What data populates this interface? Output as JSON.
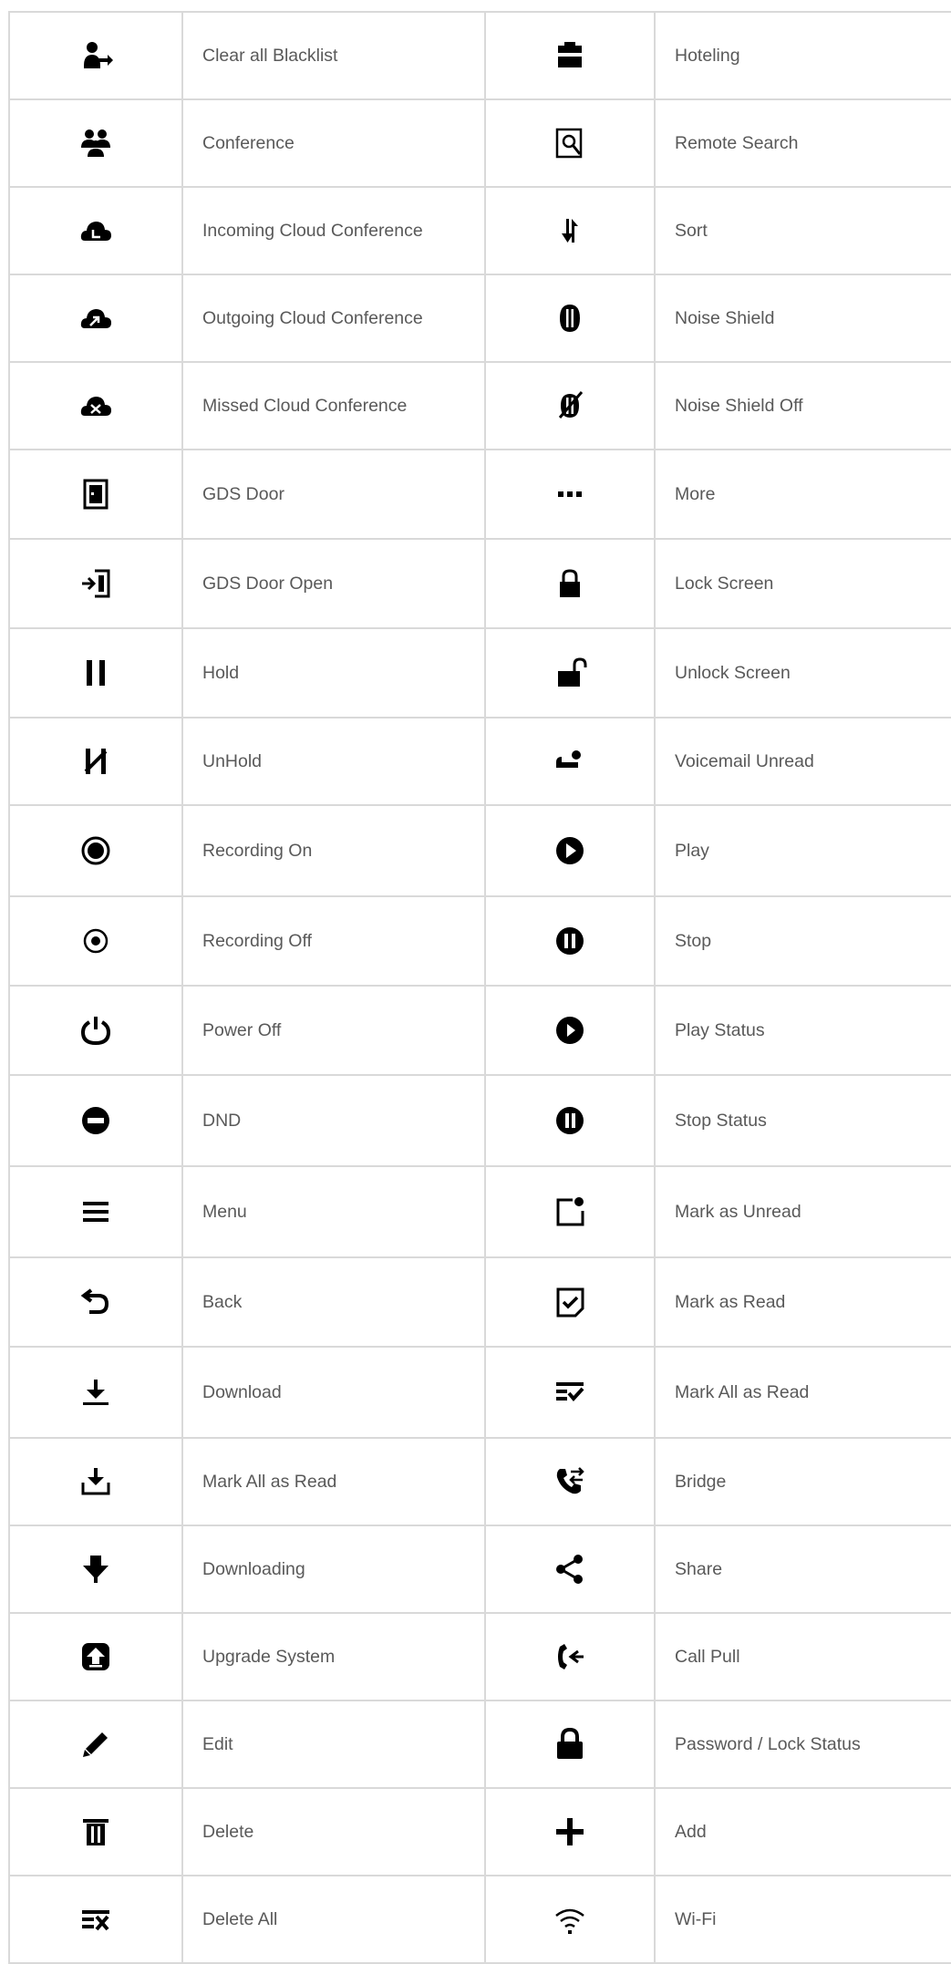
{
  "rows": [
    {
      "left": {
        "icon": "clear-blacklist-icon",
        "label": "Clear all Blacklist"
      },
      "right": {
        "icon": "hoteling-icon",
        "label": "Hoteling"
      }
    },
    {
      "left": {
        "icon": "conference-icon",
        "label": "Conference"
      },
      "right": {
        "icon": "remote-search-icon",
        "label": "Remote Search"
      }
    },
    {
      "left": {
        "icon": "incoming-cloud-conference-icon",
        "label": "Incoming Cloud Conference"
      },
      "right": {
        "icon": "sort-icon",
        "label": "Sort"
      }
    },
    {
      "left": {
        "icon": "outgoing-cloud-conference-icon",
        "label": "Outgoing Cloud Conference"
      },
      "right": {
        "icon": "noise-shield-icon",
        "label": "Noise Shield"
      }
    },
    {
      "left": {
        "icon": "missed-cloud-conference-icon",
        "label": "Missed Cloud Conference"
      },
      "right": {
        "icon": "noise-shield-off-icon",
        "label": " Noise Shield Off"
      }
    },
    {
      "left": {
        "icon": "gds-door-icon",
        "label": "GDS Door"
      },
      "right": {
        "icon": "more-icon",
        "label": "More"
      }
    },
    {
      "left": {
        "icon": "gds-door-open-icon",
        "label": "GDS Door Open"
      },
      "right": {
        "icon": "lock-screen-icon",
        "label": "Lock Screen"
      }
    },
    {
      "left": {
        "icon": "hold-icon",
        "label": "Hold"
      },
      "right": {
        "icon": "unlock-screen-icon",
        "label": "Unlock Screen"
      }
    },
    {
      "left": {
        "icon": "unhold-icon",
        "label": "UnHold"
      },
      "right": {
        "icon": "voicemail-unread-icon",
        "label": "Voicemail Unread"
      }
    },
    {
      "left": {
        "icon": "recording-on-icon",
        "label": "Recording On"
      },
      "right": {
        "icon": "play-icon",
        "label": "Play"
      }
    },
    {
      "left": {
        "icon": "recording-off-icon",
        "label": "Recording Off"
      },
      "right": {
        "icon": "stop-icon",
        "label": "Stop"
      }
    },
    {
      "left": {
        "icon": "power-off-icon",
        "label": "Power Off"
      },
      "right": {
        "icon": "play-status-icon",
        "label": "Play Status"
      }
    },
    {
      "left": {
        "icon": "dnd-icon",
        "label": "DND"
      },
      "right": {
        "icon": "stop-status-icon",
        "label": "Stop Status"
      }
    },
    {
      "left": {
        "icon": "menu-icon",
        "label": "Menu"
      },
      "right": {
        "icon": "mark-as-unread-icon",
        "label": "Mark as Unread"
      }
    },
    {
      "left": {
        "icon": "back-icon",
        "label": "Back"
      },
      "right": {
        "icon": "mark-as-read-icon",
        "label": "Mark as Read"
      }
    },
    {
      "left": {
        "icon": "download-icon",
        "label": "Download"
      },
      "right": {
        "icon": "mark-all-as-read-icon",
        "label": "Mark All as Read"
      }
    },
    {
      "left": {
        "icon": "download-tray-icon",
        "label": "Mark All as Read"
      },
      "right": {
        "icon": "bridge-icon",
        "label": "Bridge"
      }
    },
    {
      "left": {
        "icon": "downloading-icon",
        "label": "Downloading"
      },
      "right": {
        "icon": "share-icon",
        "label": "Share"
      }
    },
    {
      "left": {
        "icon": "upgrade-system-icon",
        "label": "Upgrade System"
      },
      "right": {
        "icon": "call-pull-icon",
        "label": "Call Pull"
      }
    },
    {
      "left": {
        "icon": "edit-icon",
        "label": "Edit"
      },
      "right": {
        "icon": "password-lock-icon",
        "label": "Password / Lock Status"
      }
    },
    {
      "left": {
        "icon": "delete-icon",
        "label": "Delete"
      },
      "right": {
        "icon": "add-icon",
        "label": "Add"
      }
    },
    {
      "left": {
        "icon": "delete-all-icon",
        "label": "Delete All"
      },
      "right": {
        "icon": "wifi-icon",
        "label": "Wi-Fi"
      }
    }
  ]
}
